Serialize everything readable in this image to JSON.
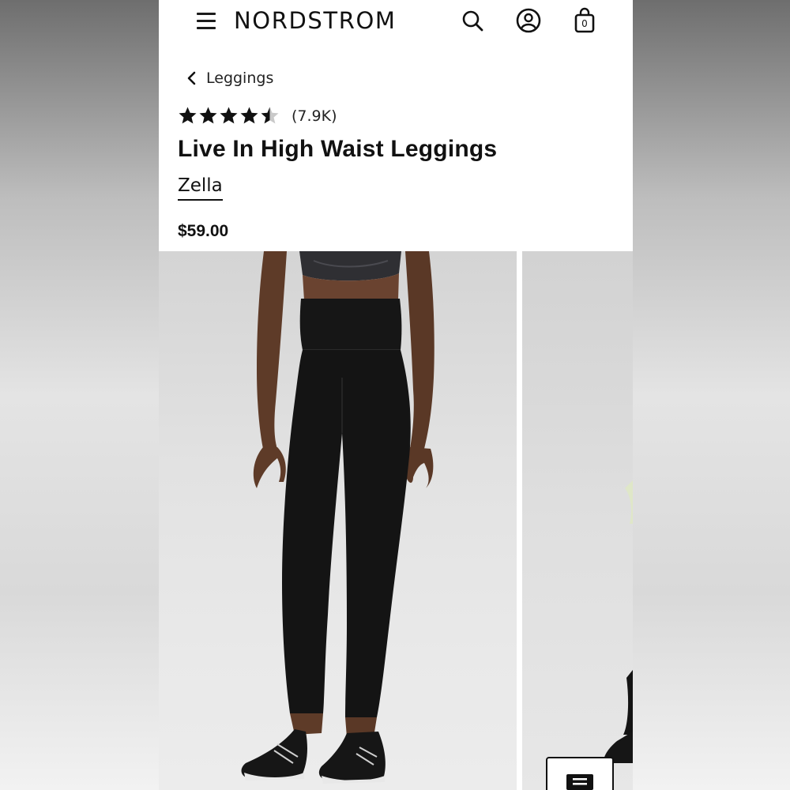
{
  "header": {
    "logo": "NORDSTROM",
    "bag_count": "0",
    "icons": [
      "menu-icon",
      "search-icon",
      "account-icon",
      "shopping-bag-icon"
    ]
  },
  "breadcrumb": {
    "label": "Leggings"
  },
  "product": {
    "rating": 4.5,
    "rating_count": "(7.9K)",
    "title": "Live In High Waist Leggings",
    "brand": "Zella",
    "price": "$59.00"
  },
  "gallery": {
    "images": [
      "product-photo-front",
      "product-photo-next"
    ]
  },
  "colors": {
    "text": "#111111",
    "background": "#ffffff",
    "photo_bg": "#e2e2e2",
    "leggings": "#141414",
    "skin": "#5a3826"
  }
}
